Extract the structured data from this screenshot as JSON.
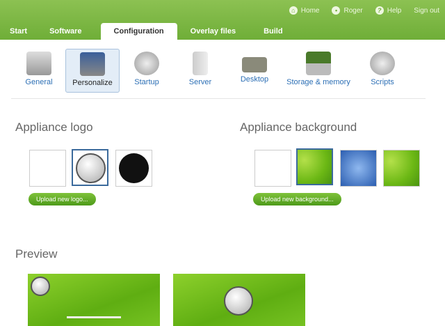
{
  "top_links": [
    {
      "icon": "home-icon",
      "label": "Home"
    },
    {
      "icon": "user-icon",
      "label": "Roger"
    },
    {
      "icon": "help-icon",
      "label": "Help"
    },
    {
      "label": "Sign out"
    }
  ],
  "tabs": [
    "Start",
    "Software",
    "Configuration",
    "Overlay files",
    "Build"
  ],
  "active_tab": "Configuration",
  "subnav": [
    "General",
    "Personalize",
    "Startup",
    "Server",
    "Desktop",
    "Storage & memory",
    "Scripts"
  ],
  "active_subnav": "Personalize",
  "logo_section": {
    "title": "Appliance logo",
    "upload": "Upload new logo..."
  },
  "background_section": {
    "title": "Appliance background",
    "upload": "Upload new background..."
  },
  "preview": {
    "title": "Preview"
  },
  "colors": {
    "accent": "#7ab648",
    "link": "#2c6fb5"
  }
}
